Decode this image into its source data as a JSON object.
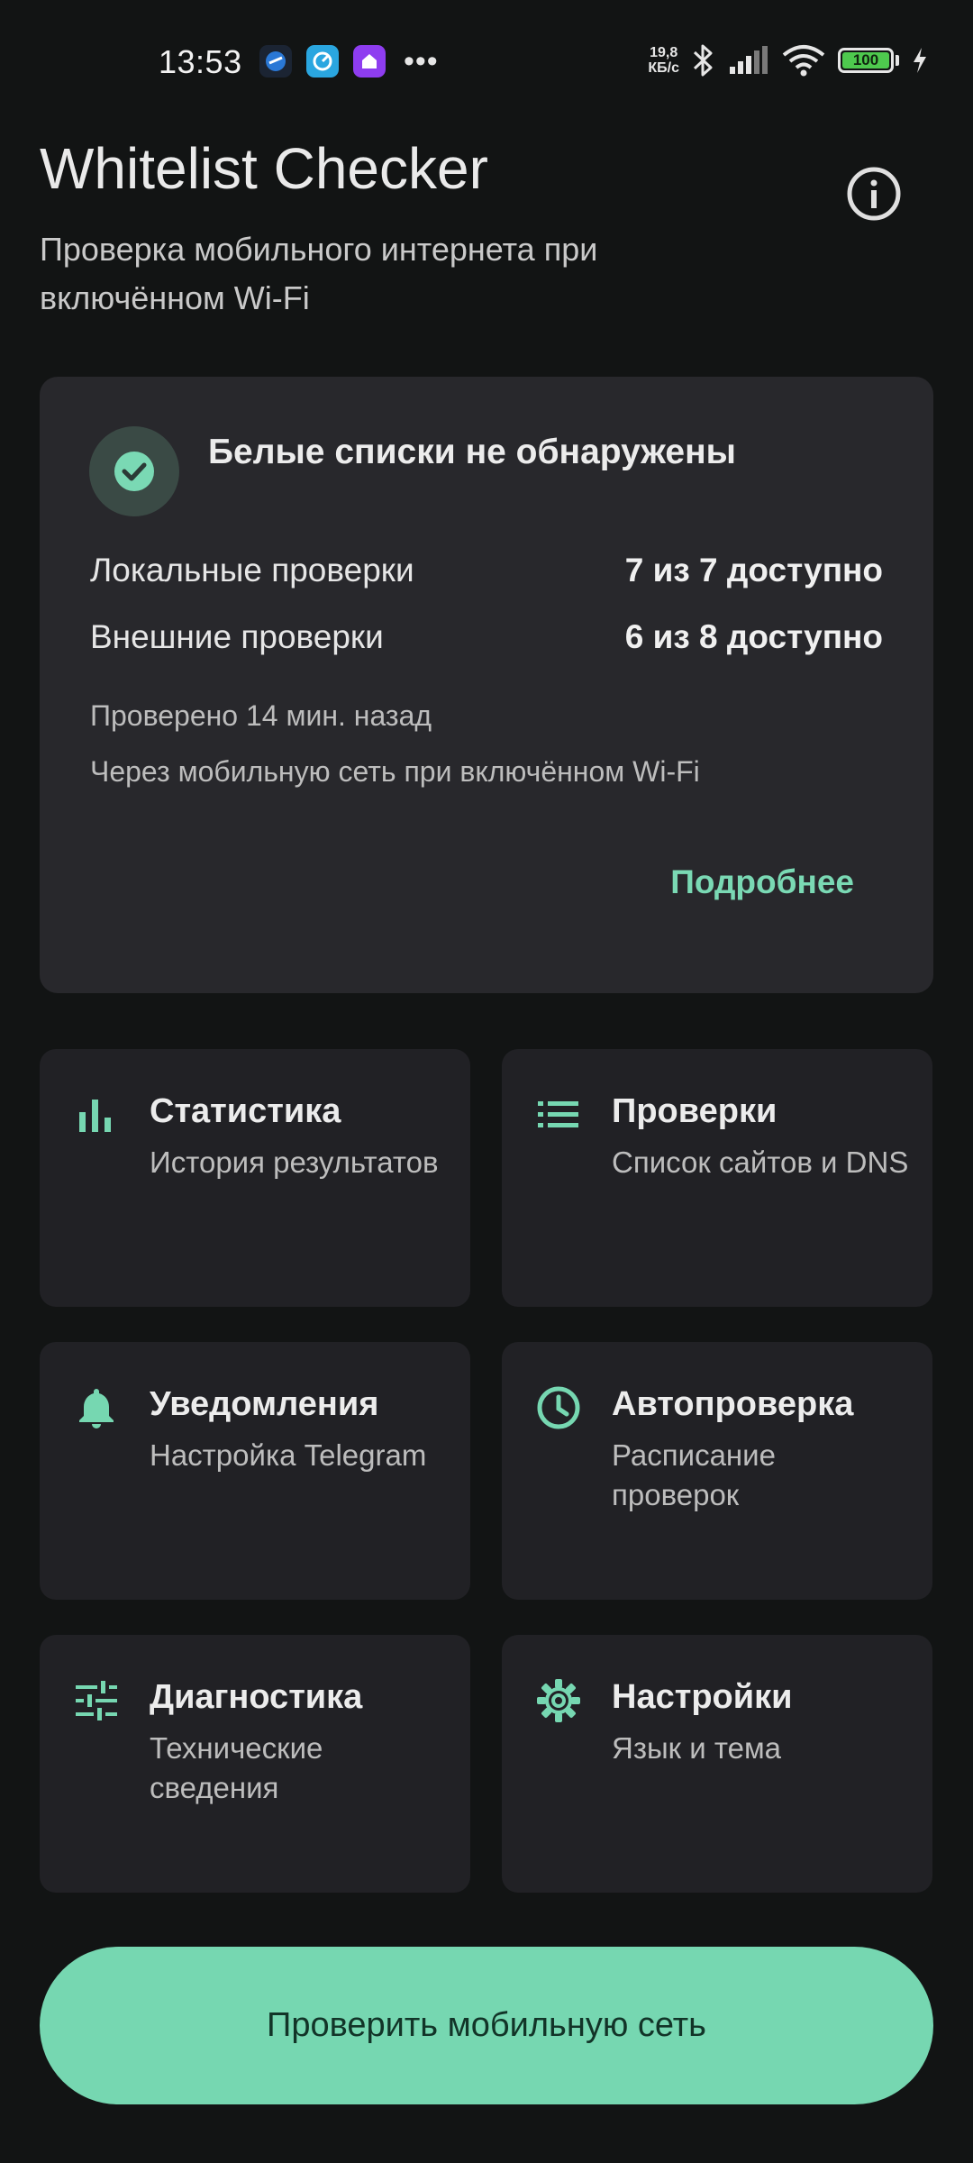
{
  "status_bar": {
    "time": "13:53",
    "net_speed_value": "19,8",
    "net_speed_unit": "КБ/с",
    "battery": "100",
    "more": "•••"
  },
  "header": {
    "title": "Whitelist Checker",
    "subtitle": "Проверка мобильного интернета при включённом Wi-Fi"
  },
  "status_card": {
    "title": "Белые списки не обнаружены",
    "rows": [
      {
        "label": "Локальные проверки",
        "value": "7 из 7 доступно"
      },
      {
        "label": "Внешние проверки",
        "value": "6 из 8 доступно"
      }
    ],
    "checked_ago": "Проверено 14 мин. назад",
    "via": "Через мобильную сеть при включённом Wi-Fi",
    "details_label": "Подробнее"
  },
  "tiles": [
    {
      "title": "Статистика",
      "subtitle": "История результатов",
      "icon": "bar-chart-icon"
    },
    {
      "title": "Проверки",
      "subtitle": "Список сайтов и DNS",
      "icon": "list-icon"
    },
    {
      "title": "Уведомления",
      "subtitle": "Настройка Telegram",
      "icon": "bell-icon"
    },
    {
      "title": "Автопроверка",
      "subtitle": "Расписание проверок",
      "icon": "clock-icon"
    },
    {
      "title": "Диагностика",
      "subtitle": "Технические сведения",
      "icon": "sliders-icon"
    },
    {
      "title": "Настройки",
      "subtitle": "Язык и тема",
      "icon": "gear-icon"
    }
  ],
  "primary_button": {
    "label": "Проверить мобильную сеть"
  },
  "colors": {
    "background": "#121414",
    "card": "#28282c",
    "tile": "#212125",
    "accent": "#76d7b1"
  }
}
